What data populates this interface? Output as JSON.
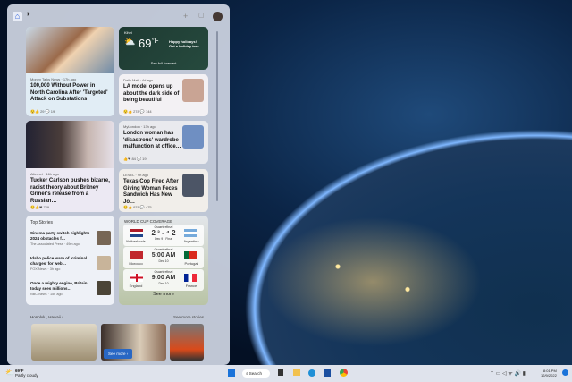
{
  "topbar": {
    "home": "home-icon",
    "play": "play-icon",
    "add": "plus-icon",
    "expand": "expand-icon"
  },
  "weather": {
    "location": "Kihei",
    "temp": "69",
    "unit": "°F",
    "promo_line1": "Happy holidays!",
    "promo_line2": "Get a holiday tree",
    "forecast": "See full forecast"
  },
  "news": [
    {
      "source": "Money Talks News · 17h ago",
      "title": "100,000 Without Power in North Carolina After 'Targeted' Attack on Substations",
      "reactions": "29",
      "comments": "19"
    },
    {
      "source": "Daily Mail · 4d ago",
      "title": "LA model opens up about the dark side of being beautiful",
      "reactions": "278",
      "comments": "144"
    },
    {
      "source": "Alternet · 16h ago",
      "title": "Tucker Carlson pushes bizarre, racist theory about Britney Griner's release from a Russian…",
      "reactions": "729",
      "comments": ""
    },
    {
      "source": "MyLondon · 13h ago",
      "title": "London woman has 'disastrous' wardrobe malfunction at office…",
      "reactions": "84",
      "comments": "19"
    },
    {
      "source": "LEVEL · 9h ago",
      "title": "Texas Cop Fired After Giving Woman Feces Sandwich Has New Jo…",
      "reactions": "978",
      "comments": "475"
    }
  ],
  "top_stories": {
    "title": "Top Stories",
    "items": [
      {
        "title": "Sinema party switch highlights 2024 obstacles f…",
        "source": "The Associated Press · 49m ago"
      },
      {
        "title": "Idaho police warn of 'criminal charges' for web…",
        "source": "FOX News · 3h ago"
      },
      {
        "title": "Once a mighty engine, Britain today sees millions…",
        "source": "NBC News · 15h ago"
      }
    ]
  },
  "worldcup": {
    "title": "WORLD CUP COVERAGE",
    "see_more": "See more",
    "matches": [
      {
        "stage": "Quarterfinal",
        "home": "Netherlands",
        "away": "Argentina",
        "center": "2 ³ - ⁴ 2",
        "sub": "Dec 9 · Final"
      },
      {
        "stage": "Quarterfinal",
        "home": "Morocco",
        "away": "Portugal",
        "center": "5:00 AM",
        "sub": "Dec 10"
      },
      {
        "stage": "Quarterfinal",
        "home": "England",
        "away": "France",
        "center": "9:00 AM",
        "sub": "Dec 10"
      }
    ]
  },
  "local": {
    "title": "Honolulu, Hawaii",
    "see_more_stories": "See more stories",
    "see_more": "See more"
  },
  "taskbar": {
    "temp": "69°F",
    "condition": "Partly cloudy",
    "search": "Search",
    "time": "8:01 PM",
    "date": "12/9/2022"
  }
}
